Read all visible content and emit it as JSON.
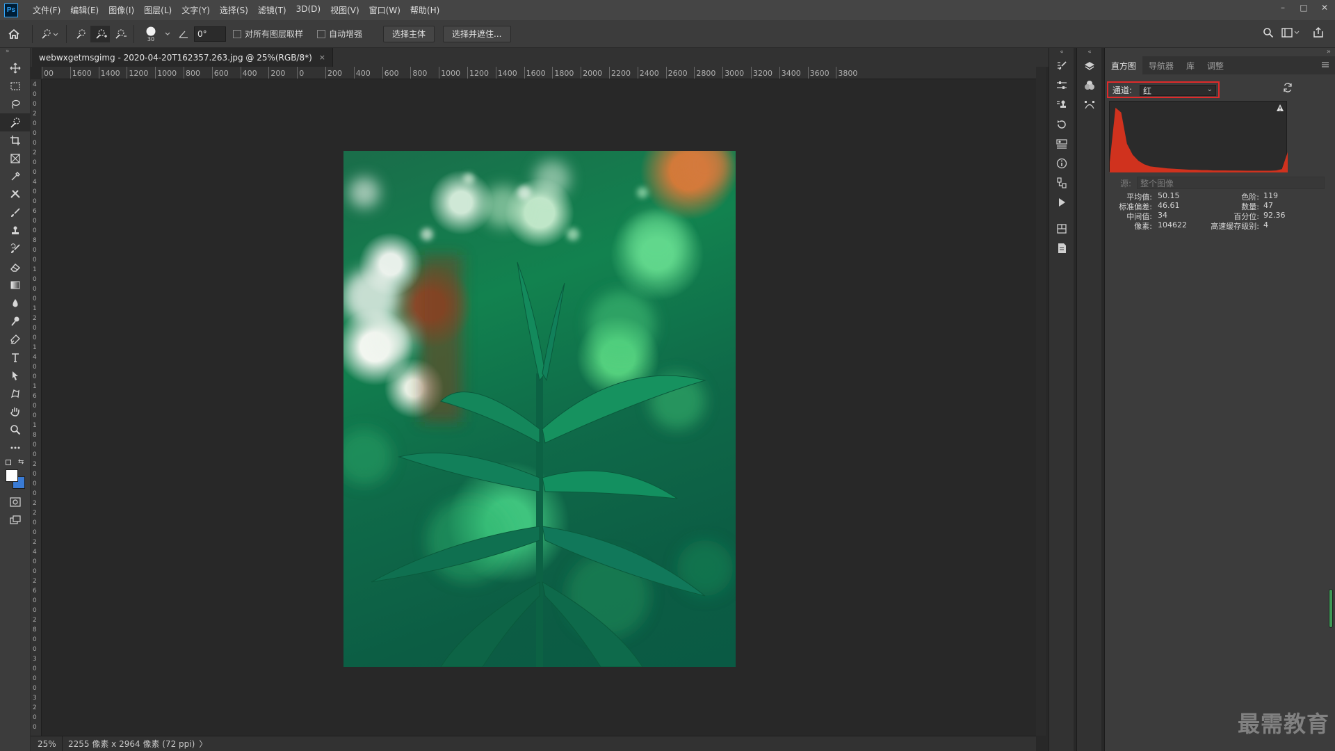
{
  "app": {
    "logo_text": "Ps",
    "menu": [
      "文件(F)",
      "编辑(E)",
      "图像(I)",
      "图层(L)",
      "文字(Y)",
      "选择(S)",
      "滤镜(T)",
      "3D(D)",
      "视图(V)",
      "窗口(W)",
      "帮助(H)"
    ],
    "window_controls": {
      "minimize": "–",
      "maximize": "□",
      "close": "✕"
    }
  },
  "options": {
    "brush_size": "30",
    "angle_value": "0°",
    "sample_all_layers": "对所有图层取样",
    "auto_enhance": "自动增强",
    "select_subject": "选择主体",
    "select_and_mask": "选择并遮住..."
  },
  "document": {
    "tab_title": "webwxgetmsgimg - 2020-04-20T162357.263.jpg @ 25%(RGB/8*)",
    "tab_close": "×"
  },
  "ruler_h_labels": [
    "00",
    "1600",
    "1400",
    "1200",
    "1000",
    "800",
    "600",
    "400",
    "200",
    "0",
    "200",
    "400",
    "600",
    "800",
    "1000",
    "1200",
    "1400",
    "1600",
    "1800",
    "2000",
    "2200",
    "2400",
    "2600",
    "2800",
    "3000",
    "3200",
    "3400",
    "3600",
    "3800"
  ],
  "ruler_v_digits": [
    "4",
    "0",
    "0",
    "2",
    "0",
    "0",
    "0",
    "2",
    "0",
    "0",
    "4",
    "0",
    "0",
    "6",
    "0",
    "0",
    "8",
    "0",
    "0",
    "1",
    "0",
    "0",
    "0",
    "1",
    "2",
    "0",
    "0",
    "1",
    "4",
    "0",
    "0",
    "1",
    "6",
    "0",
    "0",
    "1",
    "8",
    "0",
    "0",
    "2",
    "0",
    "0",
    "0",
    "2",
    "2",
    "0",
    "0",
    "2",
    "4",
    "0",
    "0",
    "2",
    "6",
    "0",
    "0",
    "2",
    "8",
    "0",
    "0",
    "3",
    "0",
    "0",
    "0",
    "3",
    "2",
    "0",
    "0"
  ],
  "status": {
    "zoom": "25%",
    "info": "2255 像素 x 2964 像素 (72 ppi)",
    "arrow": "〉"
  },
  "panel": {
    "tabs": [
      "直方图",
      "导航器",
      "库",
      "调整"
    ],
    "active_tab": "直方图",
    "channel_label": "通道:",
    "channel_value": "红",
    "source_label": "源:",
    "source_value": "整个图像",
    "stats_left": [
      {
        "label": "平均值:",
        "value": "50.15"
      },
      {
        "label": "标准偏差:",
        "value": "46.61"
      },
      {
        "label": "中间值:",
        "value": "34"
      },
      {
        "label": "像素:",
        "value": "104622"
      }
    ],
    "stats_right": [
      {
        "label": "色阶:",
        "value": "119"
      },
      {
        "label": "数量:",
        "value": "47"
      },
      {
        "label": "百分位:",
        "value": "92.36"
      },
      {
        "label": "高速缓存级别:",
        "value": "4"
      }
    ]
  },
  "histogram": {
    "channel": "red",
    "color": "#d0321e",
    "levels": [
      0,
      32,
      64,
      96,
      128,
      160,
      192,
      224,
      255
    ],
    "values": [
      0.15,
      0.95,
      0.88,
      0.42,
      0.26,
      0.17,
      0.12,
      0.09,
      0.08,
      0.07,
      0.06,
      0.055,
      0.05,
      0.045,
      0.04,
      0.04,
      0.035,
      0.035,
      0.03,
      0.03,
      0.03,
      0.028,
      0.028,
      0.027,
      0.026,
      0.026,
      0.025,
      0.025,
      0.026,
      0.03,
      0.05,
      0.3
    ]
  },
  "watermark": "最需教育",
  "colors": {
    "accent_highlight": "#e02a2a",
    "histogram_red": "#d0321e",
    "panel_bg": "#3c3c3c",
    "canvas_bg": "#282828"
  }
}
